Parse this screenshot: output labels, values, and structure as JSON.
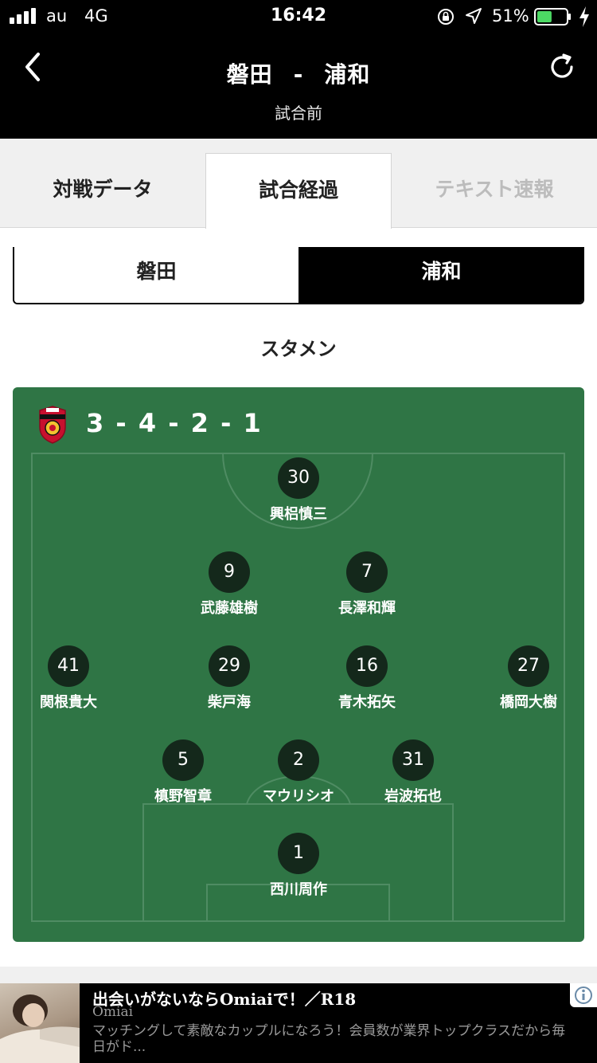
{
  "status_bar": {
    "carrier": "au",
    "network": "4G",
    "time": "16:42",
    "battery_pct": "51%",
    "battery_level": 0.51
  },
  "header": {
    "home": "磐田",
    "separator": "-",
    "away": "浦和",
    "status": "試合前"
  },
  "tabs": [
    {
      "label": "対戦データ",
      "active": false
    },
    {
      "label": "試合経過",
      "active": true
    },
    {
      "label": "テキスト速報",
      "active": false
    }
  ],
  "team_switch": {
    "home": "磐田",
    "away": "浦和",
    "selected": "浦和"
  },
  "lineup": {
    "section_title": "スタメン",
    "formation": "3 - 4 - 2 - 1",
    "players": [
      {
        "number": "30",
        "name": "興梠慎三"
      },
      {
        "number": "9",
        "name": "武藤雄樹"
      },
      {
        "number": "7",
        "name": "長澤和輝"
      },
      {
        "number": "41",
        "name": "関根貴大"
      },
      {
        "number": "29",
        "name": "柴戸海"
      },
      {
        "number": "16",
        "name": "青木拓矢"
      },
      {
        "number": "27",
        "name": "橋岡大樹"
      },
      {
        "number": "5",
        "name": "槙野智章"
      },
      {
        "number": "2",
        "name": "マウリシオ"
      },
      {
        "number": "31",
        "name": "岩波拓也"
      },
      {
        "number": "1",
        "name": "西川周作"
      }
    ]
  },
  "ad": {
    "headline": "出会いがないならOmiaiで！／R18",
    "source": "Omiai",
    "body": "マッチングして素敵なカップルになろう！会員数が業界トップクラスだから毎日がド..."
  },
  "colors": {
    "pitch": "#2f7545",
    "player_badge": "#14281b",
    "header_bg": "#000000",
    "battery": "#4cd964"
  }
}
